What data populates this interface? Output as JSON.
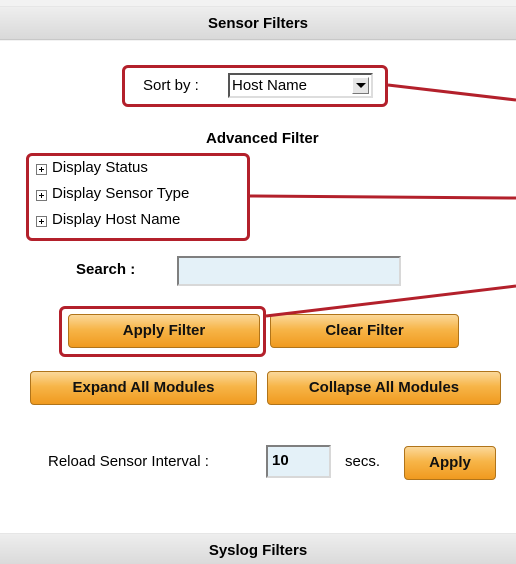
{
  "sensor_filters": {
    "title": "Sensor Filters",
    "sort_by_label": "Sort by :",
    "sort_by_value": "Host Name",
    "advanced_filter_title": "Advanced Filter",
    "advanced_items": [
      "Display Status",
      "Display Sensor Type",
      "Display Host Name"
    ],
    "search_label": "Search :",
    "search_value": "",
    "apply_filter_label": "Apply Filter",
    "clear_filter_label": "Clear Filter",
    "expand_all_label": "Expand All Modules",
    "collapse_all_label": "Collapse All Modules",
    "reload_interval_label": "Reload Sensor Interval :",
    "reload_interval_value": "10",
    "reload_interval_unit": "secs.",
    "apply_label": "Apply"
  },
  "syslog_filters": {
    "title": "Syslog Filters"
  },
  "colors": {
    "highlight": "#b3202b",
    "button": "#f7b548",
    "input_bg": "#e4f1f8"
  }
}
